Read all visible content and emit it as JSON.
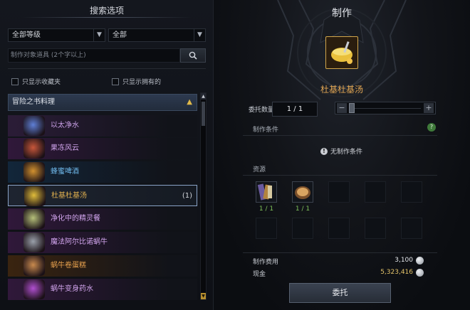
{
  "left_panel": {
    "title": "搜索选项",
    "grade_select": "全部等级",
    "type_select": "全部",
    "search_placeholder": "制作对象道具 (2个字以上)",
    "filter_favorites": "只显示收藏夹",
    "filter_owned": "只显示拥有的",
    "category": "冒险之书料理",
    "items": [
      {
        "name": "以太净水",
        "color": "#c9a0e6",
        "bg": "#2b1c37",
        "icon": "potion-bottle-icon",
        "thumb": "#5f7fd6",
        "count": ""
      },
      {
        "name": "果冻风云",
        "color": "#d3a6ef",
        "bg": "#30183a",
        "icon": "jelly-jar-icon",
        "thumb": "#c8573a",
        "count": ""
      },
      {
        "name": "蜂蜜啤酒",
        "color": "#6fb8ea",
        "bg": "#12263a",
        "icon": "honey-beer-icon",
        "thumb": "#d2912f",
        "count": ""
      },
      {
        "name": "杜基杜基汤",
        "color": "#e1b14f",
        "bg": "#1e2430",
        "icon": "soup-bowl-icon",
        "thumb": "#e0bd3b",
        "count": "(1)"
      },
      {
        "name": "净化中的精灵餐",
        "color": "#d3a6ef",
        "bg": "#30183a",
        "icon": "elf-meal-icon",
        "thumb": "#b6c07a",
        "count": ""
      },
      {
        "name": "魔法阿尔比诺蜗牛",
        "color": "#d3a6ef",
        "bg": "#30183a",
        "icon": "snail-icon",
        "thumb": "#9aa0aa",
        "count": ""
      },
      {
        "name": "蜗牛卷蛋糕",
        "color": "#e6a04d",
        "bg": "#3a2410",
        "icon": "roll-cake-icon",
        "thumb": "#c98a4e",
        "count": ""
      },
      {
        "name": "蜗牛变身药水",
        "color": "#d3a6ef",
        "bg": "#30183a",
        "icon": "transform-potion-icon",
        "thumb": "#b04fd0",
        "count": ""
      }
    ]
  },
  "right_panel": {
    "title": "制作",
    "item_name": "杜基杜基汤",
    "quantity_label": "委托数量",
    "quantity_value": "1 / 1",
    "conditions_label": "制作条件",
    "help_glyph": "?",
    "info_glyph": "!",
    "no_conditions": "无制作条件",
    "resources_label": "资源",
    "resources": [
      {
        "icon": "material-bundle-icon",
        "count": "1 / 1",
        "thumb": "#8e6a3c"
      },
      {
        "icon": "soup-ingredient-icon",
        "count": "1 / 1",
        "thumb": "#c6874a"
      }
    ],
    "cost_label": "制作费用",
    "cost_value": "3,100",
    "gold_label": "现金",
    "gold_value": "5,323,416",
    "commit_button": "委托"
  },
  "colors": {
    "accent_gold": "#e0a553",
    "highlight_border": "#8aa3c7",
    "ok_green": "#7fc25a"
  }
}
